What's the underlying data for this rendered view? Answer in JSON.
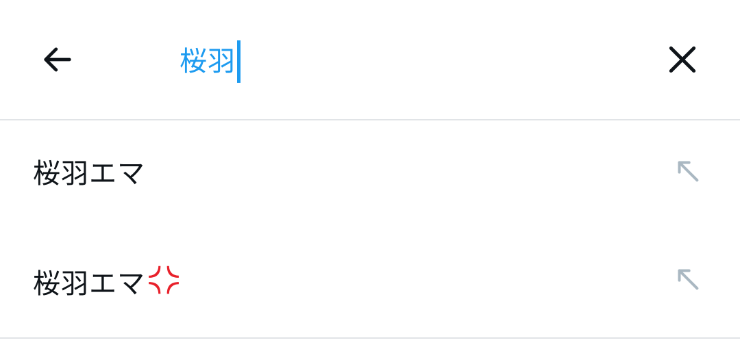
{
  "search": {
    "query": "桜羽",
    "icons": {
      "back": "arrow-left-icon",
      "clear": "close-icon"
    }
  },
  "suggestions": [
    {
      "text": "桜羽エマ",
      "emoji": null,
      "action_icon": "arrow-up-left-icon"
    },
    {
      "text": "桜羽エマ",
      "emoji": "anger-symbol-icon",
      "action_icon": "arrow-up-left-icon"
    }
  ],
  "colors": {
    "accent": "#1d9bf0",
    "text": "#0f1419",
    "divider": "#e1e4e7",
    "fill_arrow": "#aab8c2",
    "anger": "#e8202a"
  }
}
